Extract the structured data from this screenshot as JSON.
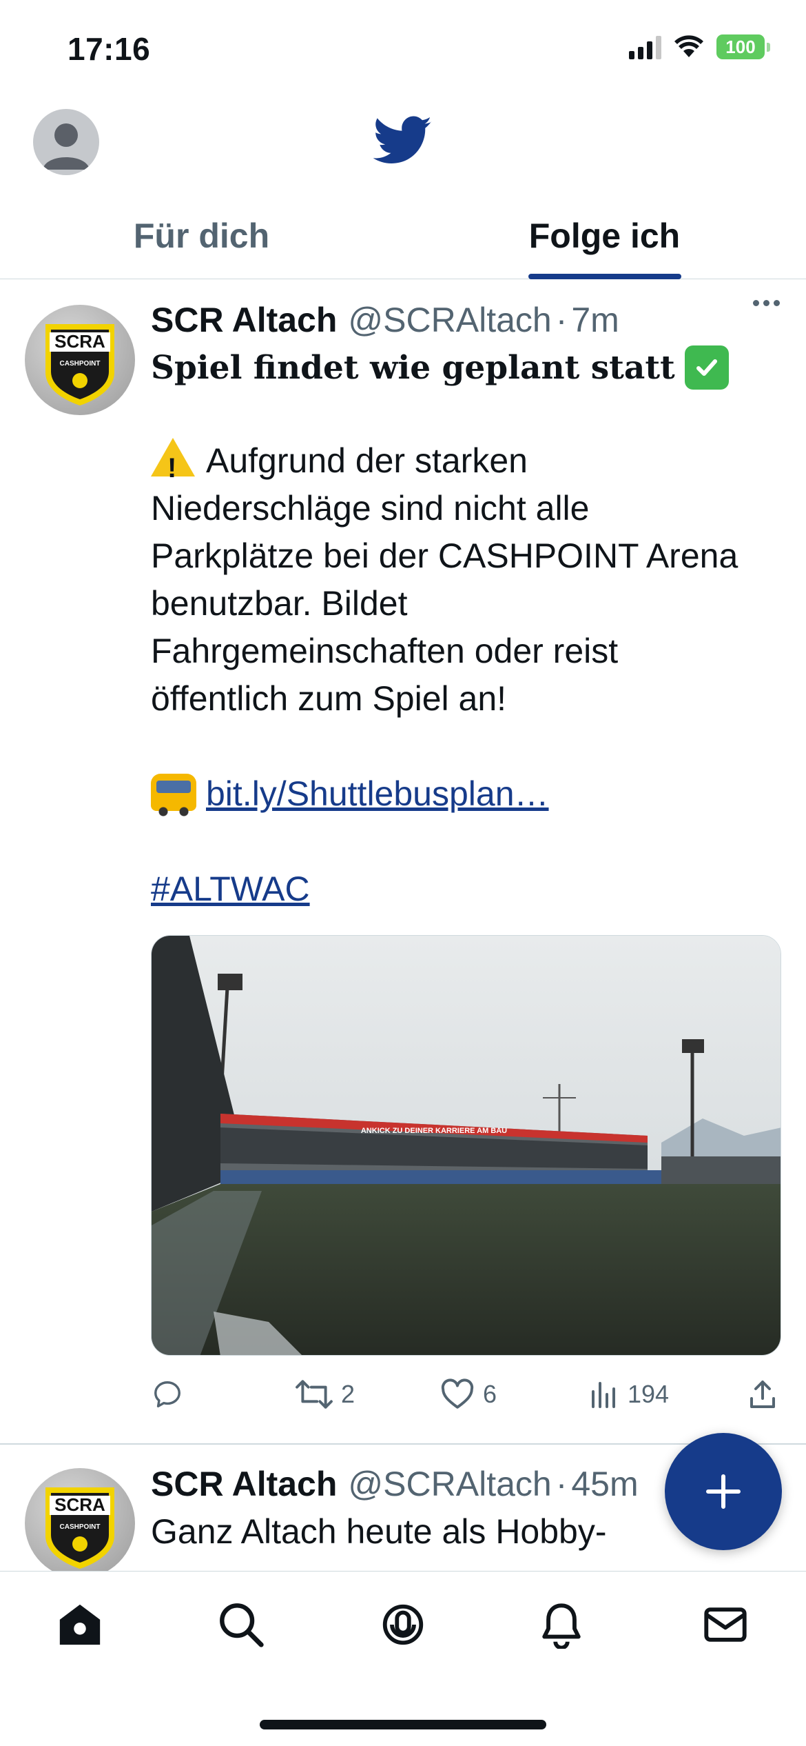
{
  "status_bar": {
    "time": "17:16",
    "battery": "100"
  },
  "tabs": [
    {
      "label": "Für dich",
      "active": false
    },
    {
      "label": "Folge ich",
      "active": true
    }
  ],
  "tweets": [
    {
      "name": "SCR Altach",
      "handle": "@SCRAltach",
      "dot": "·",
      "time": "7m",
      "avatar_text": "SCRA",
      "avatar_sub": "CASHPOINT",
      "headline": "Spiel findet wie geplant statt",
      "body_lines": [
        "Aufgrund der starken",
        "Niederschläge sind nicht alle",
        "Parkplätze bei der CASHPOINT Arena",
        "benutzbar. Bildet",
        "Fahrgemeinschaften oder reist",
        "öffentlich zum Spiel an!"
      ],
      "link": "bit.ly/Shuttlebusplan…",
      "hashtag": "#ALTWAC",
      "stadium_banner": "ANKICK ZU DEINER KARRIERE AM BAU",
      "stats": {
        "replies": "",
        "retweets": "2",
        "likes": "6",
        "views": "194"
      }
    },
    {
      "name": "SCR Altach",
      "handle": "@SCRAltach",
      "dot": "·",
      "time": "45m",
      "avatar_text": "SCRA",
      "avatar_sub": "CASHPOINT",
      "body_line": "Ganz Altach heute als Hobby-"
    }
  ],
  "colors": {
    "accent": "#163b8a",
    "text": "#0f1419",
    "muted": "#536471"
  },
  "nav_icons": [
    "home-icon",
    "search-icon",
    "spaces-icon",
    "notifications-icon",
    "messages-icon"
  ]
}
